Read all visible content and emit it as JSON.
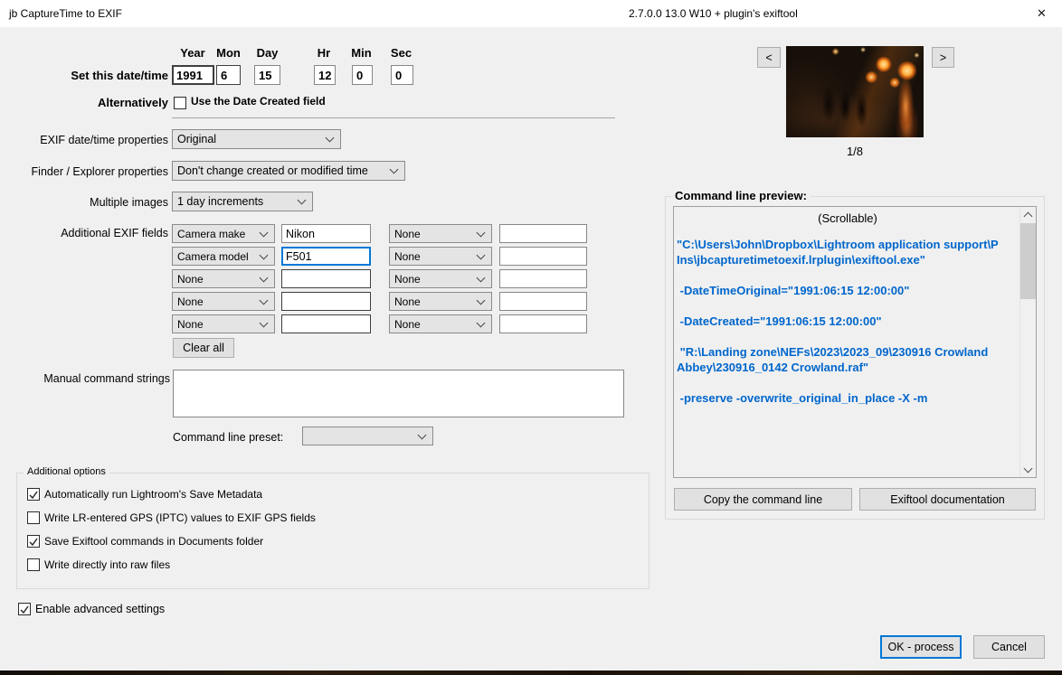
{
  "titlebar": {
    "title": "jb CaptureTime to EXIF",
    "version": "2.7.0.0 13.0 W10 + plugin's exiftool",
    "close_glyph": "✕"
  },
  "colors": {
    "accent": "#0078d7",
    "command_text": "#0066cc"
  },
  "datetime": {
    "set_label": "Set this date/time",
    "headers": [
      "Year",
      "Mon",
      "Day",
      "Hr",
      "Min",
      "Sec"
    ],
    "year": "1991",
    "mon": "6",
    "day": "15",
    "hr": "12",
    "min": "0",
    "sec": "0",
    "alternatively_label": "Alternatively",
    "use_date_created": {
      "label": "Use the Date Created field",
      "checked": false
    }
  },
  "properties": {
    "exif": {
      "label": "EXIF date/time properties",
      "value": "Original"
    },
    "finder": {
      "label": "Finder / Explorer properties",
      "value": "Don't change created or modified time"
    },
    "multiple": {
      "label": "Multiple images",
      "value": "1 day increments"
    }
  },
  "additional_exif": {
    "label": "Additional EXIF fields",
    "left": [
      {
        "field": "Camera make",
        "value": "Nikon"
      },
      {
        "field": "Camera model",
        "value": "F501"
      },
      {
        "field": "None",
        "value": ""
      },
      {
        "field": "None",
        "value": ""
      },
      {
        "field": "None",
        "value": ""
      }
    ],
    "right": [
      {
        "field": "None",
        "value": ""
      },
      {
        "field": "None",
        "value": ""
      },
      {
        "field": "None",
        "value": ""
      },
      {
        "field": "None",
        "value": ""
      },
      {
        "field": "None",
        "value": ""
      }
    ],
    "clear_all": "Clear all"
  },
  "manual": {
    "label": "Manual command strings",
    "value": "",
    "preset_label": "Command line preset:",
    "preset_value": ""
  },
  "options": {
    "title": "Additional options",
    "items": [
      {
        "label": "Automatically run Lightroom's Save Metadata",
        "checked": true
      },
      {
        "label": "Write LR-entered GPS (IPTC) values to EXIF GPS fields",
        "checked": false
      },
      {
        "label": "Save Exiftool commands in Documents folder",
        "checked": true
      },
      {
        "label": "Write directly into raw files",
        "checked": false
      }
    ]
  },
  "advanced": {
    "label": "Enable advanced settings",
    "checked": true
  },
  "thumbnail": {
    "prev": "<",
    "next": ">",
    "counter": "1/8"
  },
  "command_preview": {
    "title": "Command line preview:",
    "note": "(Scrollable)",
    "paragraphs": [
      "\"C:\\Users\\John\\Dropbox\\Lightroom application support\\P\nIns\\jbcapturetimetoexif.lrplugin\\exiftool.exe\"",
      " -DateTimeOriginal=\"1991:06:15 12:00:00\"",
      " -DateCreated=\"1991:06:15 12:00:00\"",
      " \"R:\\Landing zone\\NEFs\\2023\\2023_09\\230916 Crowland\nAbbey\\230916_0142 Crowland.raf\"",
      " -preserve -overwrite_original_in_place -X -m"
    ],
    "copy_button": "Copy the command line",
    "doc_button": "Exiftool documentation"
  },
  "footer": {
    "ok": "OK - process",
    "cancel": "Cancel"
  }
}
